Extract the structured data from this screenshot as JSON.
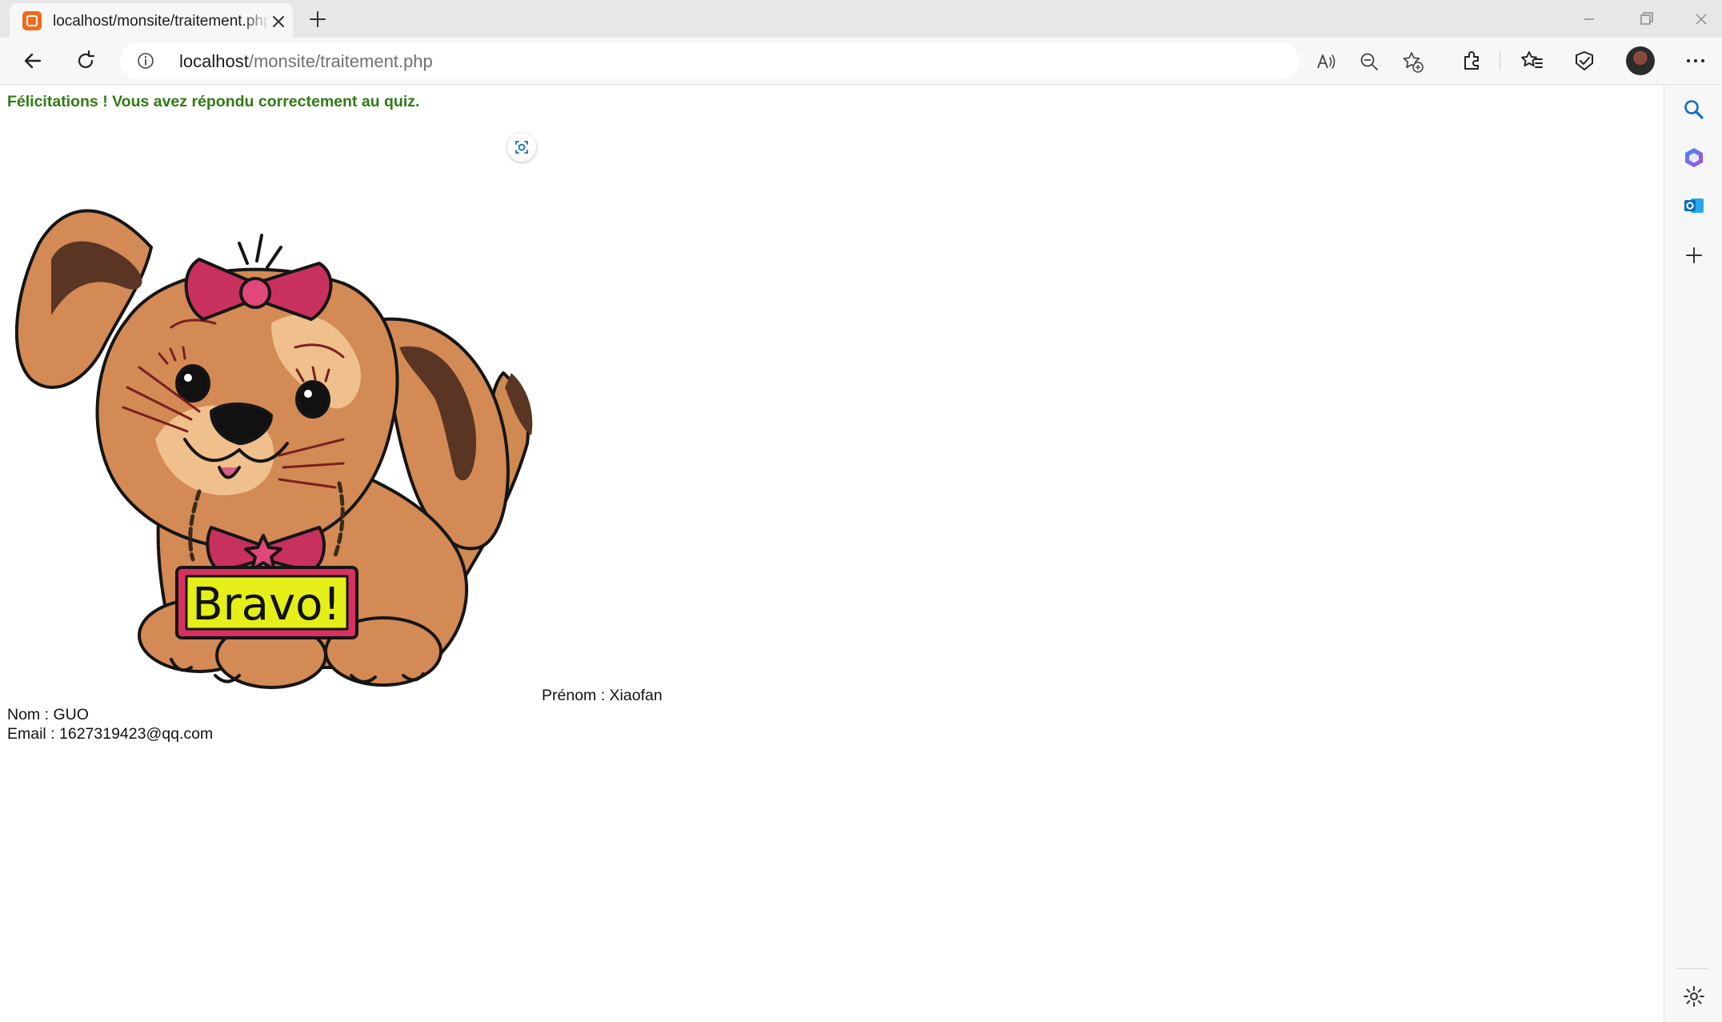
{
  "browser": {
    "tab_title": "localhost/monsite/traitement.php",
    "url_host": "localhost",
    "url_path": "/monsite/traitement.php"
  },
  "page": {
    "message": "Félicitations ! Vous avez répondu correctement au quiz.",
    "image_sign_text": "Bravo!",
    "prenom_label": "Prénom : ",
    "prenom_value": "Xiaofan",
    "nom_label": "Nom : ",
    "nom_value": "GUO",
    "email_label": "Email : ",
    "email_value": "1627319423@qq.com"
  },
  "colors": {
    "message_green": "#2f7b14",
    "accent_blue": "#0f6cbd"
  },
  "icons": {
    "tab_favicon": "xampp-icon",
    "back": "arrow-left-icon",
    "reload": "reload-icon",
    "site_info": "info-icon",
    "read_aloud": "read-aloud-icon",
    "zoom": "zoom-out-icon",
    "favorite_add": "star-plus-icon",
    "extensions": "puzzle-icon",
    "favorites": "favorites-icon",
    "copilot": "copilot-icon",
    "more": "more-icon",
    "side_search": "search-icon",
    "side_copilot": "copilot-icon",
    "side_outlook": "outlook-icon",
    "side_add": "plus-icon",
    "side_settings": "gear-icon"
  }
}
